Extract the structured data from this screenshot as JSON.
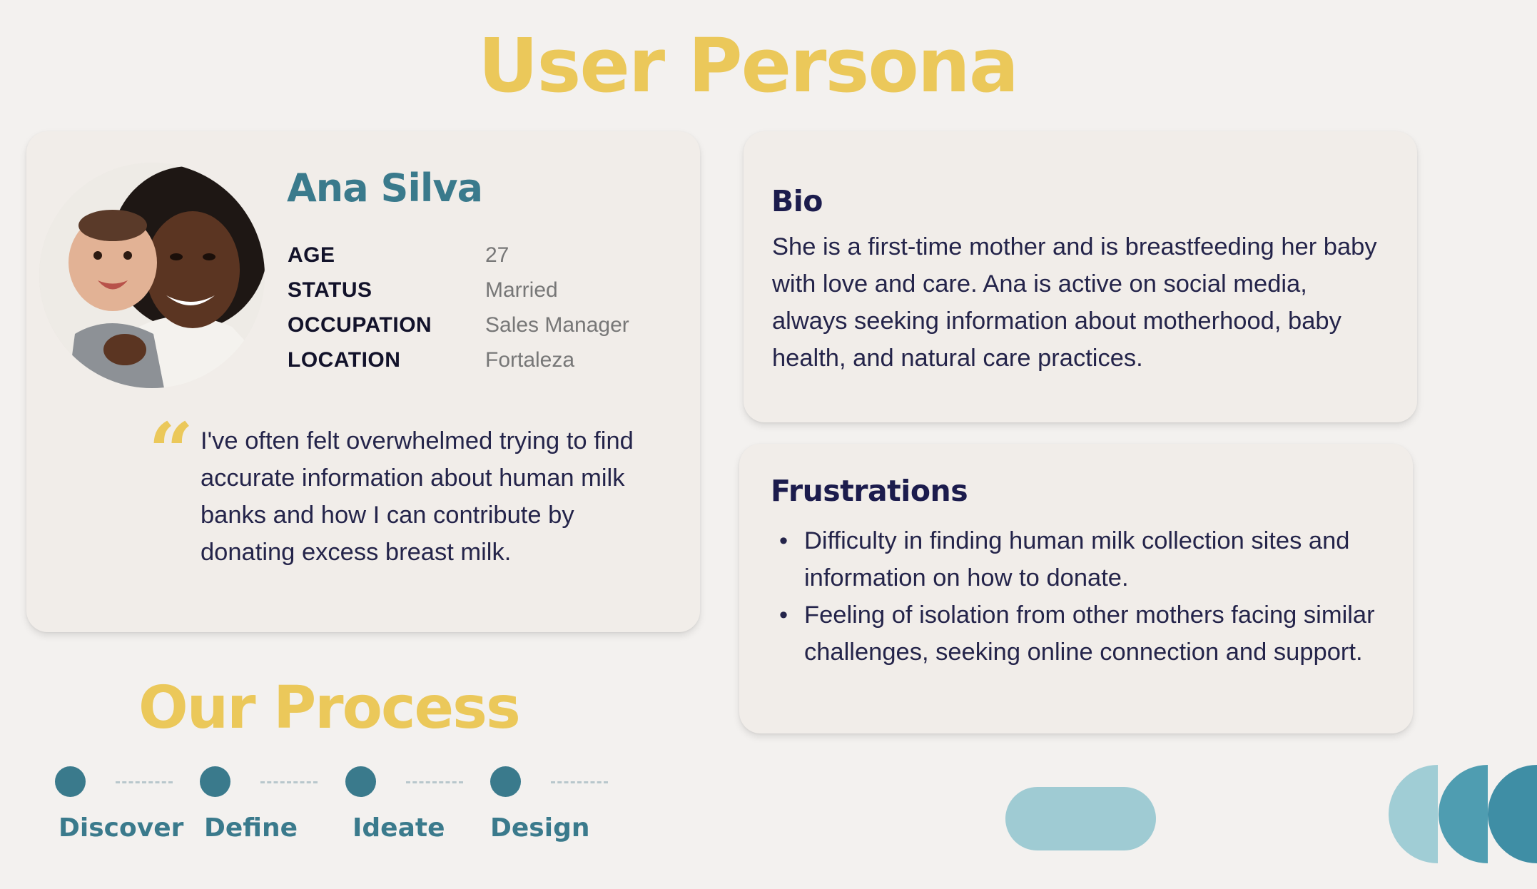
{
  "title": "User Persona",
  "persona": {
    "name": "Ana Silva",
    "fields": [
      {
        "label": "AGE",
        "value": "27"
      },
      {
        "label": "STATUS",
        "value": "Married"
      },
      {
        "label": "OCCUPATION",
        "value": "Sales Manager"
      },
      {
        "label": "LOCATION",
        "value": "Fortaleza"
      }
    ],
    "quote_mark": "“",
    "quote": "I've often felt overwhelmed trying to find accurate information about human milk banks and how I can contribute by donating excess breast milk."
  },
  "bio": {
    "heading": "Bio",
    "text": "She is a first-time mother and is breastfeeding her baby with love and care. Ana is active on social media, always seeking information about motherhood, baby health, and natural care practices."
  },
  "frustrations": {
    "heading": "Frustrations",
    "items": [
      "Difficulty in finding human milk collection sites and information on how to donate.",
      "Feeling of isolation from other mothers facing similar challenges, seeking online connection and support."
    ]
  },
  "process": {
    "title": "Our Process",
    "steps": [
      "Discover",
      "Define",
      "Ideate",
      "Design"
    ]
  },
  "colors": {
    "accent_yellow": "#ebc85a",
    "accent_teal": "#3a7a8c",
    "navy_text": "#1c1c4d",
    "card_bg": "#f1ede9",
    "page_bg": "#f3f1ef"
  }
}
